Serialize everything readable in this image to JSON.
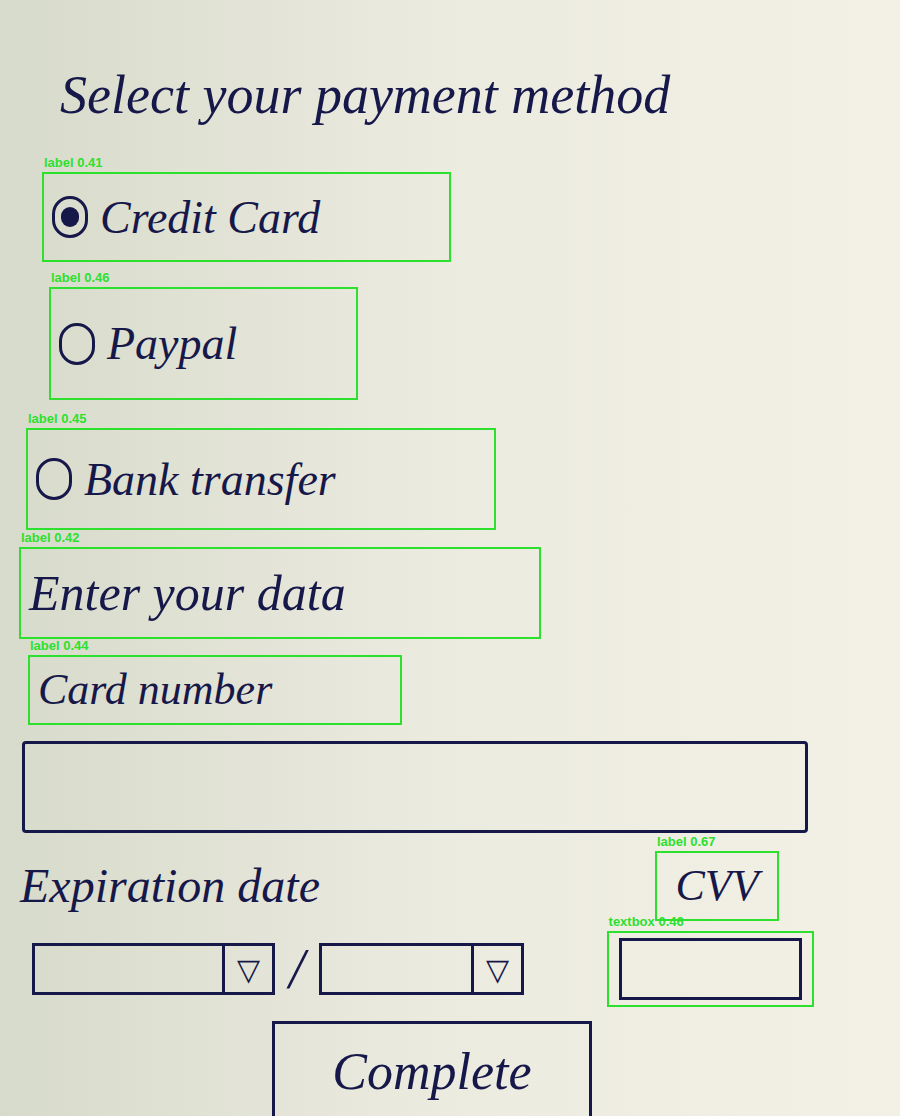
{
  "title": "Select your payment method",
  "payment_options": [
    {
      "label": "Credit Card",
      "selected": true,
      "detection": "label 0.41"
    },
    {
      "label": "Paypal",
      "selected": false,
      "detection": "label 0.46"
    },
    {
      "label": "Bank transfer",
      "selected": false,
      "detection": "label 0.45"
    }
  ],
  "section_title": {
    "text": "Enter your data",
    "detection": "label 0.42"
  },
  "card_number": {
    "label": "Card number",
    "detection": "label 0.44"
  },
  "expiration": {
    "label": "Expiration date",
    "separator": "/",
    "dropdowns": [
      {
        "icon": "▽"
      },
      {
        "icon": "▽"
      }
    ]
  },
  "cvv": {
    "label": "CVV",
    "detection": "label 0.67",
    "field_detection": "textbox 0.46"
  },
  "button": "Complete"
}
